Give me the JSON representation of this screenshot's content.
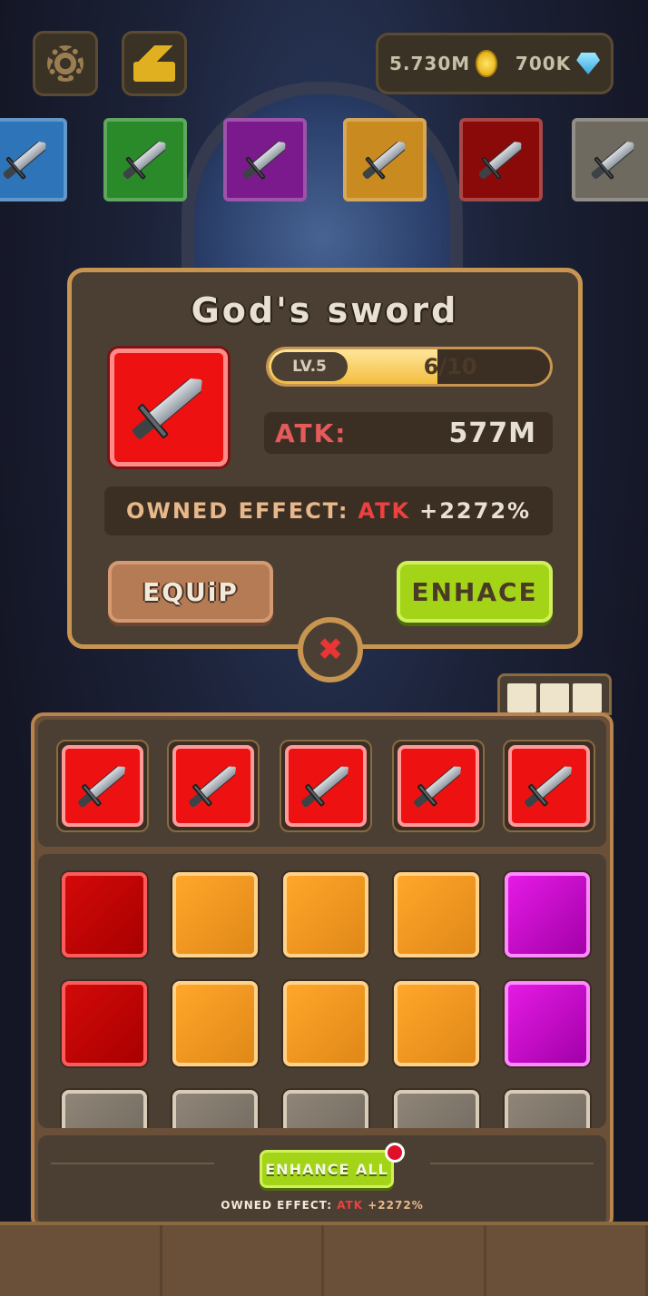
{
  "currency": {
    "gold": "5.730M",
    "gems": "700K"
  },
  "popup": {
    "title": "God's sword",
    "level_label": "LV.5",
    "progress_text": "6/10",
    "progress_fraction": 0.6,
    "atk_label": "ATK:",
    "atk_value": "577M",
    "owned_label": "OWNED EFFECT:",
    "owned_stat": "ATK",
    "owned_value": "+2272%",
    "equip_label": "EQUiP",
    "enhance_label": "ENHACE",
    "close_icon": "close-icon"
  },
  "inventory": {
    "equipped_slots": [
      "red",
      "red",
      "red",
      "red",
      "red"
    ],
    "grid": [
      [
        "red",
        "orange",
        "orange",
        "orange",
        "purple"
      ],
      [
        "red",
        "orange",
        "orange",
        "orange",
        "purple"
      ],
      [
        "gray",
        "gray",
        "gray",
        "gray",
        "gray"
      ]
    ],
    "enhance_all_label": "ENHANCE ALL",
    "owned_label": "OWNED EFFECT:",
    "owned_stat": "ATK",
    "owned_value": "+2272%"
  },
  "colors": {
    "red": "#ee1111",
    "orange": "#ffa62a",
    "purple": "#e51ae5",
    "gray": "#8f8578",
    "enhance_green": "#a4d418",
    "panel_border": "#c89551"
  },
  "icons": [
    "settings-gear-icon",
    "crown-rank-icon",
    "gold-coin-icon",
    "diamond-gem-icon",
    "sword-icon"
  ]
}
